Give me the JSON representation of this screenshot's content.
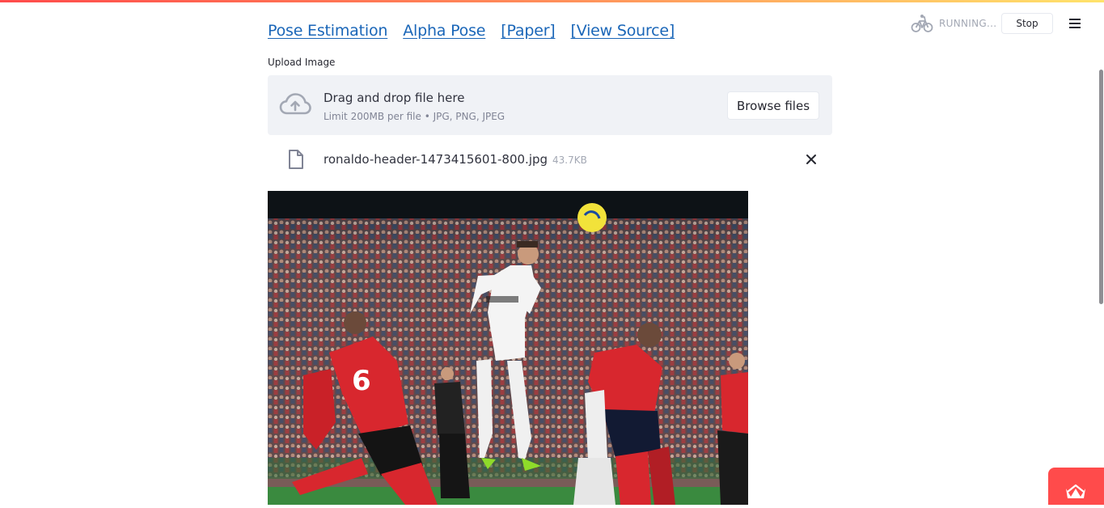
{
  "header": {
    "status_text": "RUNNING...",
    "stop_label": "Stop",
    "status_icon": "bicycle-icon",
    "menu_icon": "hamburger-menu-icon"
  },
  "nav_links": [
    {
      "label": "Pose Estimation"
    },
    {
      "label": "Alpha Pose"
    },
    {
      "label": "[Paper]"
    },
    {
      "label": "[View Source]"
    }
  ],
  "uploader": {
    "label": "Upload Image",
    "drop_title": "Drag and drop file here",
    "drop_limit": "Limit 200MB per file • JPG, PNG, JPEG",
    "browse_label": "Browse files",
    "upload_icon": "cloud-upload-icon"
  },
  "file": {
    "name": "ronaldo-header-1473415601-800.jpg",
    "size": "43.7KB",
    "file_icon": "file-icon",
    "remove_icon": "close-icon"
  },
  "image": {
    "alt": "ronaldo-header-1473415601-800.jpg"
  },
  "colors": {
    "accent": "#ff4b4b",
    "link": "#1a66b8",
    "dropzone_bg": "#f0f2f6"
  }
}
